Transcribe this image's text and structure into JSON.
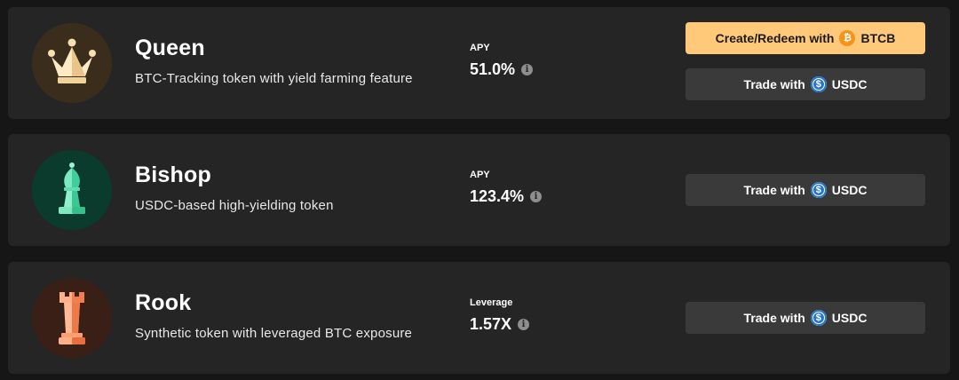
{
  "tokens": [
    {
      "name": "Queen",
      "description": "BTC-Tracking token with yield farming feature",
      "metric_label": "APY",
      "metric_value": "51.0%",
      "primary_button": {
        "label": "Create/Redeem with",
        "coin": "BTCB"
      },
      "trade_button": {
        "label": "Trade with",
        "coin": "USDC"
      },
      "icon": "crown-icon",
      "avatar_bg": "#3a2d1c"
    },
    {
      "name": "Bishop",
      "description": "USDC-based high-yielding token",
      "metric_label": "APY",
      "metric_value": "123.4%",
      "trade_button": {
        "label": "Trade with",
        "coin": "USDC"
      },
      "icon": "bishop-chess-icon",
      "avatar_bg": "#0b3b2c"
    },
    {
      "name": "Rook",
      "description": "Synthetic token with leveraged BTC exposure",
      "metric_label": "Leverage",
      "metric_value": "1.57X",
      "trade_button": {
        "label": "Trade with",
        "coin": "USDC"
      },
      "icon": "rook-chess-icon",
      "avatar_bg": "#3a1f17"
    }
  ],
  "colors": {
    "page_bg": "#161616",
    "card_bg": "#252525",
    "primary_button": "#ffc979",
    "secondary_button": "#3a3a3a",
    "usdc": "#2775ca",
    "btc": "#f7931a"
  }
}
